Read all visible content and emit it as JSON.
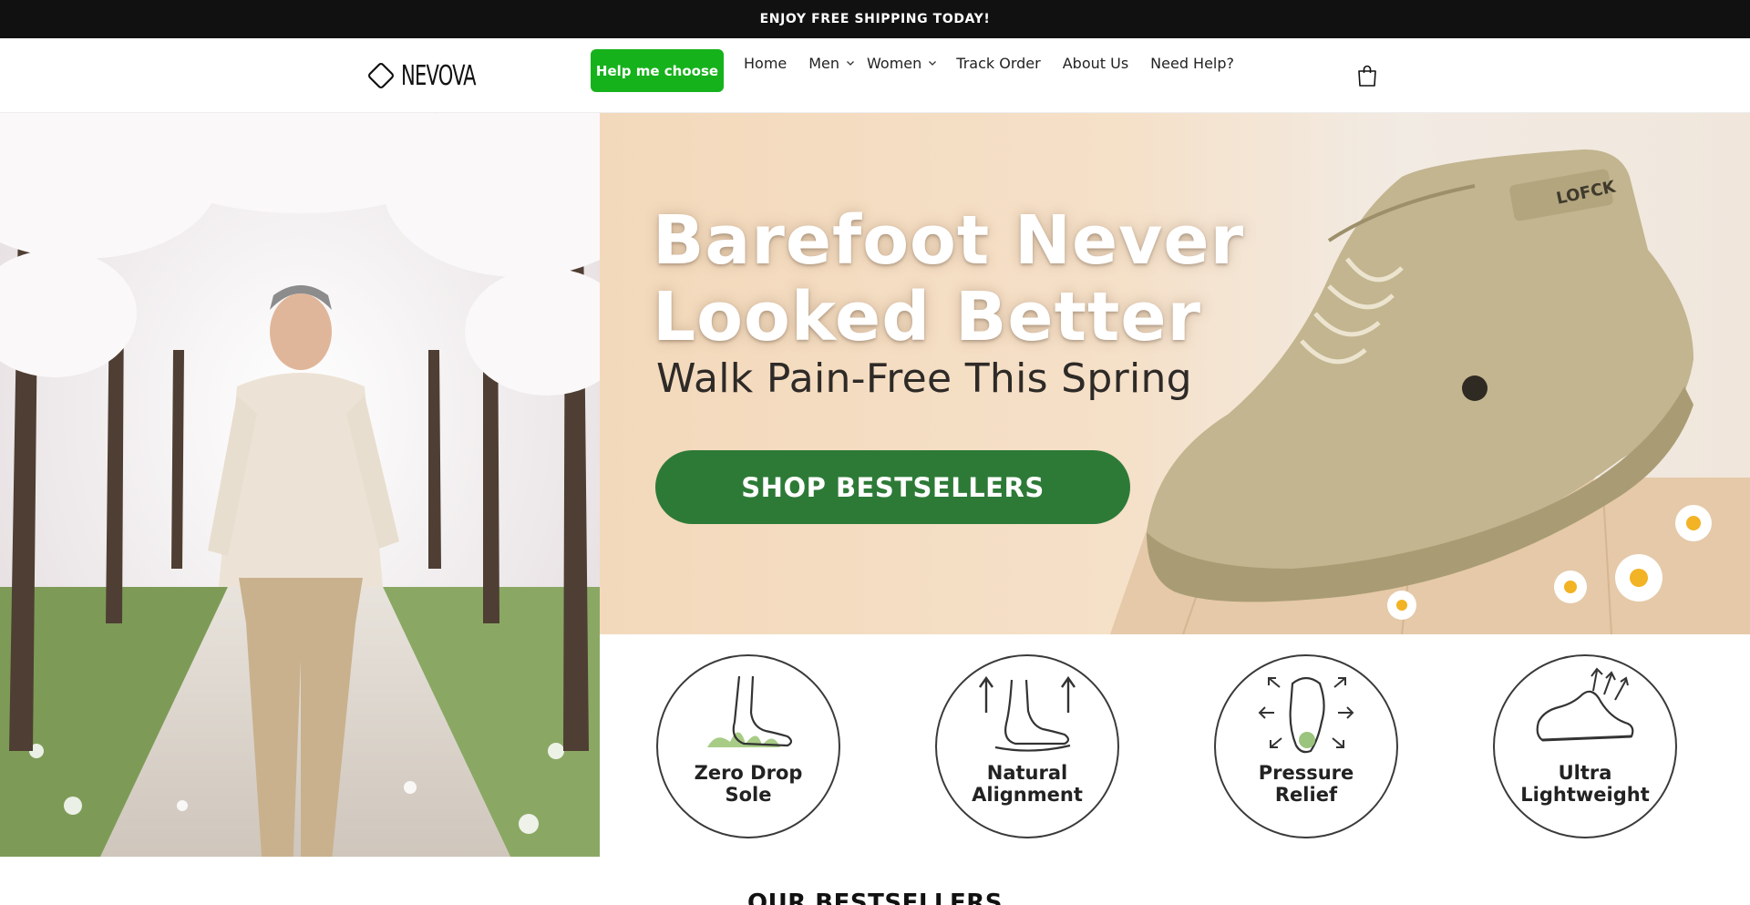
{
  "announcement": {
    "text": "ENJOY FREE SHIPPING TODAY!"
  },
  "header": {
    "logo_text": "NEVOVA",
    "help_button": "Help me choose",
    "nav": [
      {
        "label": "Home",
        "dropdown": false
      },
      {
        "label": "Men",
        "dropdown": true
      },
      {
        "label": "Women",
        "dropdown": true
      },
      {
        "label": "Track Order",
        "dropdown": false
      },
      {
        "label": "About Us",
        "dropdown": false
      },
      {
        "label": "Need Help?",
        "dropdown": false
      }
    ],
    "cart_icon": "shopping-bag-icon"
  },
  "hero": {
    "headline_line1": "Barefoot Never",
    "headline_line2": "Looked Better",
    "subheadline": "Walk Pain-Free This Spring",
    "cta": "SHOP BESTSELLERS",
    "shoe_brand": "LOFCK",
    "features": [
      {
        "line1": "Zero Drop",
        "line2": "Sole",
        "icon": "bare-foot-on-grass-icon"
      },
      {
        "line1": "Natural",
        "line2": "Alignment",
        "icon": "foot-alignment-arrows-icon"
      },
      {
        "line1": "Pressure",
        "line2": "Relief",
        "icon": "foot-pressure-points-icon"
      },
      {
        "line1": "Ultra",
        "line2": "Lightweight",
        "icon": "lightweight-sneaker-icon"
      }
    ]
  },
  "bestsellers": {
    "title": "OUR BESTSELLERS"
  },
  "colors": {
    "announcement_bg": "#111111",
    "help_button_bg": "#16b21c",
    "cta_bg": "#2d7a37",
    "hero_bg": "#f3d9bb"
  }
}
